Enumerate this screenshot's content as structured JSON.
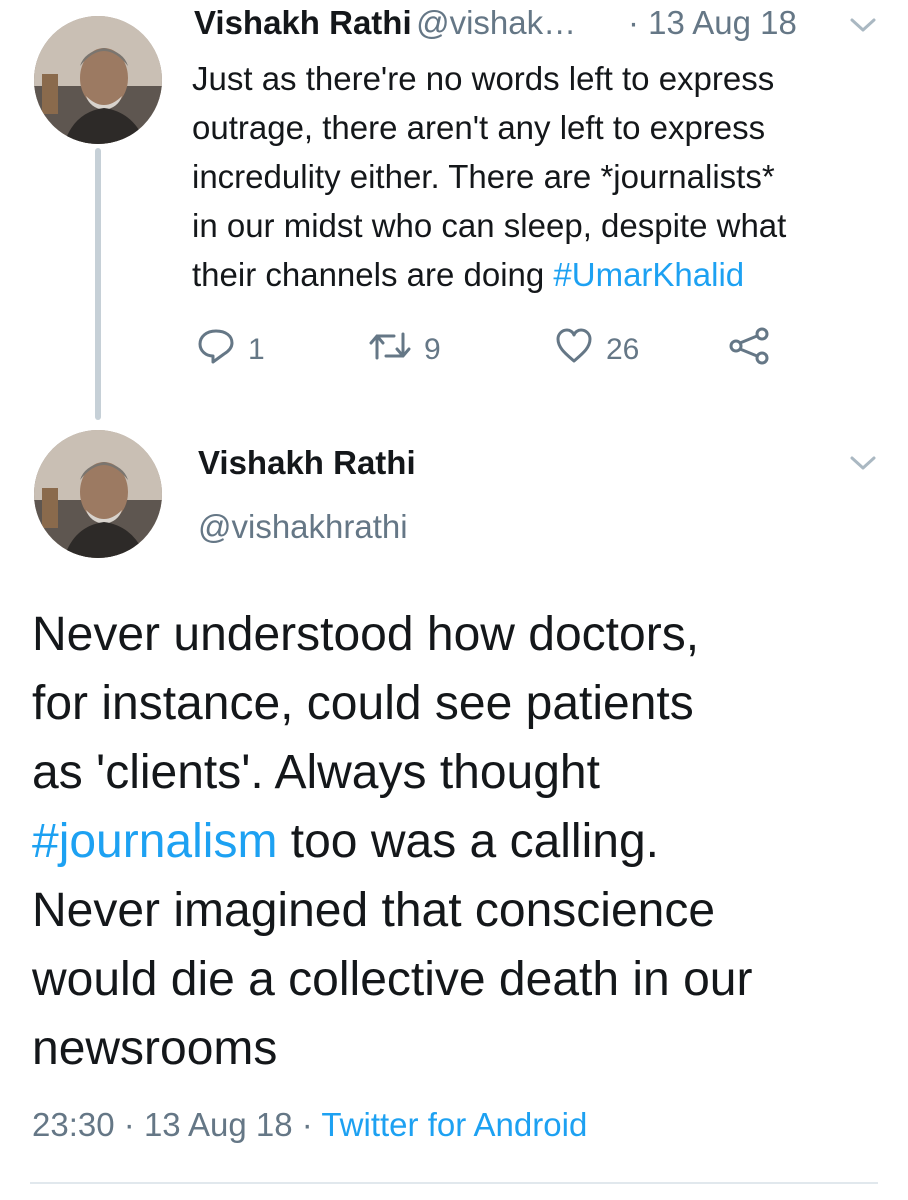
{
  "tweet1": {
    "author_name": "Vishakh Rathi",
    "author_handle": "@vishak…",
    "separator": "·",
    "date": "13 Aug 18",
    "text_lines": [
      "Just as there're no words left to express",
      "outrage, there aren't any left to express",
      "incredulity either. There are *journalists*",
      "in our midst who can sleep, despite what"
    ],
    "text_last_plain": "their channels are doing ",
    "text_last_hashtag": "#UmarKhalid",
    "replies": "1",
    "retweets": "9",
    "likes": "26"
  },
  "tweet2": {
    "author_name": "Vishakh Rathi",
    "author_handle": "@vishakhrathi",
    "text_line1": "Never understood how doctors,",
    "text_line2": "for instance, could see patients",
    "text_line3": "as 'clients'. Always thought",
    "text_hashtag": "#journalism",
    "text_line4_rest": " too was a calling.",
    "text_line5": "Never imagined that conscience",
    "text_line6": "would die a collective death in our",
    "text_line7": "newsrooms",
    "time": "23:30",
    "date": "13 Aug 18",
    "separator": "·",
    "source": "Twitter for Android"
  },
  "icons": {
    "reply": "reply-icon",
    "retweet": "retweet-icon",
    "like": "heart-icon",
    "share": "share-icon",
    "menu": "chevron-down-icon"
  },
  "colors": {
    "link": "#1da1f2",
    "secondary_text": "#657786",
    "thread_line": "#c6d0d7"
  }
}
